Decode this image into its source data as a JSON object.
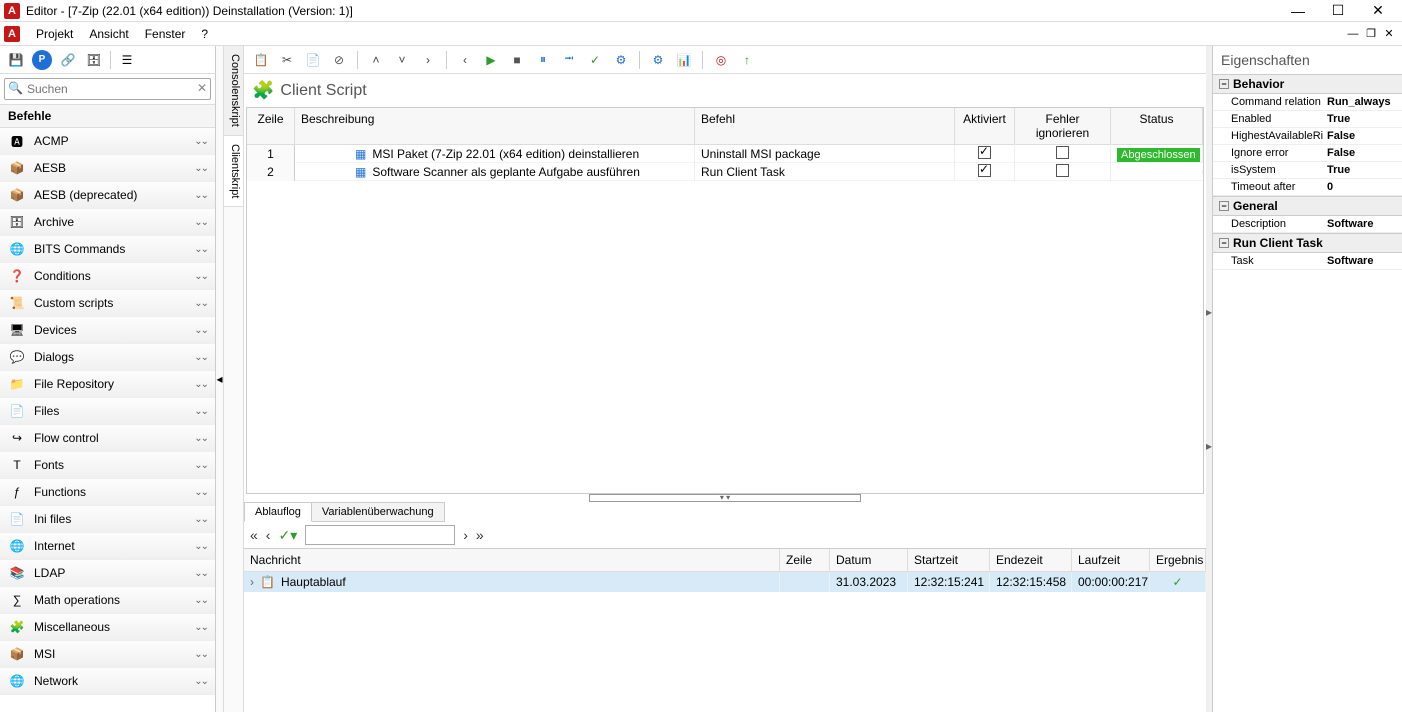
{
  "window": {
    "title": "Editor - [7-Zip (22.01 (x64 edition)) Deinstallation (Version: 1)]",
    "app_letter": "A"
  },
  "menu": {
    "projekt": "Projekt",
    "ansicht": "Ansicht",
    "fenster": "Fenster",
    "help": "?"
  },
  "search": {
    "placeholder": "Suchen"
  },
  "befehle_header": "Befehle",
  "sidebar_items": [
    {
      "label": "ACMP"
    },
    {
      "label": "AESB"
    },
    {
      "label": "AESB (deprecated)"
    },
    {
      "label": "Archive"
    },
    {
      "label": "BITS Commands"
    },
    {
      "label": "Conditions"
    },
    {
      "label": "Custom scripts"
    },
    {
      "label": "Devices"
    },
    {
      "label": "Dialogs"
    },
    {
      "label": "File Repository"
    },
    {
      "label": "Files"
    },
    {
      "label": "Flow control"
    },
    {
      "label": "Fonts"
    },
    {
      "label": "Functions"
    },
    {
      "label": "Ini files"
    },
    {
      "label": "Internet"
    },
    {
      "label": "LDAP"
    },
    {
      "label": "Math operations"
    },
    {
      "label": "Miscellaneous"
    },
    {
      "label": "MSI"
    },
    {
      "label": "Network"
    }
  ],
  "side_tabs": {
    "consolen": "Consolenskript",
    "client": "Clientskript"
  },
  "cs_title": "Client Script",
  "grid_head": {
    "zeile": "Zeile",
    "besch": "Beschreibung",
    "befehl": "Befehl",
    "akt": "Aktiviert",
    "fehl": "Fehler ignorieren",
    "status": "Status"
  },
  "rows": [
    {
      "n": "1",
      "desc": "MSI Paket (7-Zip 22.01 (x64 edition) deinstallieren",
      "cmd": "Uninstall MSI package",
      "akt": true,
      "fehl": false,
      "status": "Abgeschlossen"
    },
    {
      "n": "2",
      "desc": "Software Scanner als geplante Aufgabe ausführen",
      "cmd": "Run Client Task",
      "akt": true,
      "fehl": false,
      "status": ""
    }
  ],
  "bottom_tabs": {
    "ablauflog": "Ablauflog",
    "varwatch": "Variablenüberwachung"
  },
  "log_head": {
    "msg": "Nachricht",
    "z": "Zeile",
    "dat": "Datum",
    "st": "Startzeit",
    "et": "Endezeit",
    "lz": "Laufzeit",
    "erg": "Ergebnis"
  },
  "log_row": {
    "msg": "Hauptablauf",
    "dat": "31.03.2023",
    "st": "12:32:15:241",
    "et": "12:32:15:458",
    "lz": "00:00:00:217"
  },
  "props_title": "Eigenschaften",
  "prop_groups": {
    "behavior": "Behavior",
    "general": "General",
    "runtask": "Run Client Task"
  },
  "props": {
    "cmd_rel_k": "Command relation",
    "cmd_rel_v": "Run_always",
    "enabled_k": "Enabled",
    "enabled_v": "True",
    "highest_k": "HighestAvailableRights",
    "highest_v": "False",
    "ignore_k": "Ignore error",
    "ignore_v": "False",
    "issys_k": "isSystem",
    "issys_v": "True",
    "timeout_k": "Timeout after",
    "timeout_v": "0",
    "desc_k": "Description",
    "desc_v": "Software",
    "task_k": "Task",
    "task_v": "Software"
  }
}
